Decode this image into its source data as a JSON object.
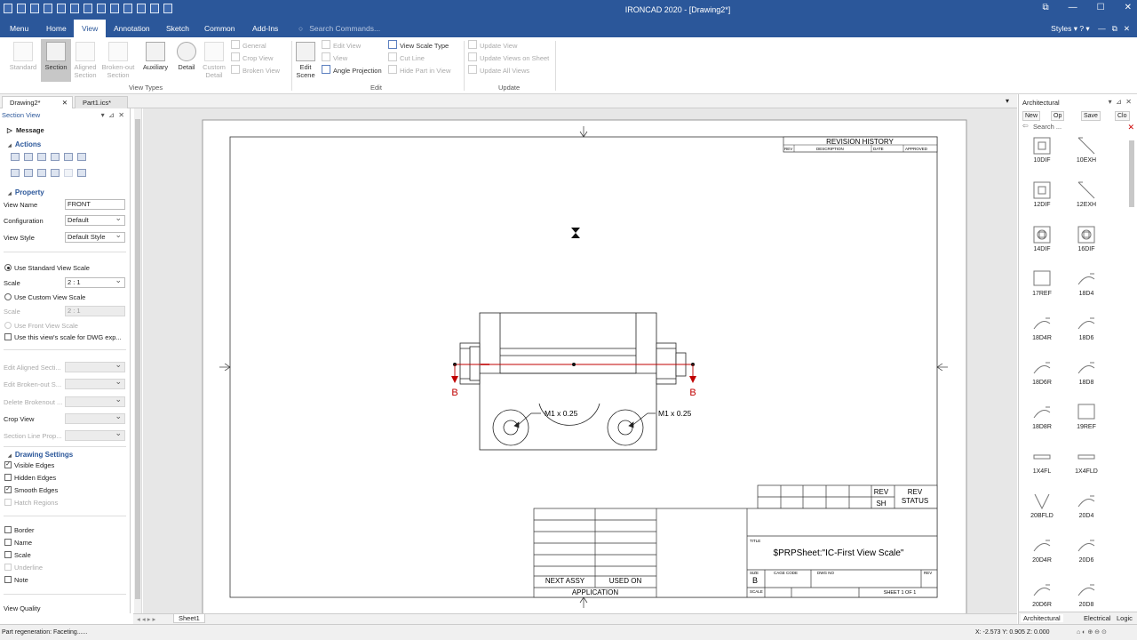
{
  "window": {
    "title": "IRONCAD 2020 - [Drawing2*]"
  },
  "menu": {
    "tabs": [
      "Menu",
      "Home",
      "View",
      "Annotation",
      "Sketch",
      "Common",
      "Add-Ins"
    ],
    "search_placeholder": "Search Commands...",
    "styles": "Styles"
  },
  "ribbon": {
    "view_types": {
      "label": "View Types",
      "standard": "Standard",
      "section": "Section",
      "aligned_section": "Aligned Section",
      "broken_out_section": "Broken-out Section",
      "auxiliary": "Auxiliary",
      "detail": "Detail",
      "custom_detail": "Custom Detail",
      "general": "General",
      "crop_view": "Crop View",
      "broken_view": "Broken View"
    },
    "edit": {
      "label": "Edit",
      "edit_scene": "Edit Scene",
      "edit_view": "Edit View",
      "view": "View",
      "angle_projection": "Angle Projection",
      "view_scale_type": "View Scale Type",
      "cut_line": "Cut Line",
      "hide_part_in_view": "Hide Part in View"
    },
    "update": {
      "label": "Update",
      "update_view": "Update View",
      "update_views_on_sheet": "Update Views on Sheet",
      "update_all_views": "Update All Views"
    }
  },
  "doc_tabs": [
    "Drawing2*",
    "Part1.ics*"
  ],
  "panel": {
    "title": "Section View",
    "message": "Message",
    "actions": "Actions",
    "property": "Property",
    "view_name_label": "View Name",
    "view_name_value": "FRONT",
    "configuration_label": "Configuration",
    "configuration_value": "Default",
    "view_style_label": "View Style",
    "view_style_value": "Default Style",
    "use_standard_scale": "Use Standard View Scale",
    "scale_label": "Scale",
    "scale_value": "2 : 1",
    "use_custom_scale": "Use Custom View Scale",
    "custom_scale_label": "Scale",
    "custom_scale_value": "2 : 1",
    "use_front_view_scale": "Use Front View Scale",
    "use_dwg_scale": "Use this view's scale for DWG exp...",
    "edit_aligned": "Edit Aligned Secti...",
    "edit_broken_out": "Edit Broken-out S...",
    "delete_brokenout": "Delete Brokenout ...",
    "crop_view": "Crop View",
    "section_line_prop": "Section Line Prop...",
    "drawing_settings": "Drawing Settings",
    "visible_edges": "Visible Edges",
    "hidden_edges": "Hidden Edges",
    "smooth_edges": "Smooth Edges",
    "hatch_regions": "Hatch Regions",
    "border": "Border",
    "name": "Name",
    "scale": "Scale",
    "underline": "Underline",
    "note": "Note",
    "view_quality": "View Quality",
    "check_mark": "✓"
  },
  "drawing": {
    "revision_history": "REVISION HISTORY",
    "rev": "REV",
    "description": "DESCRIPTION",
    "date": "DATE",
    "approved": "APPROVED",
    "section_letter": "B",
    "thread_note": "M1 x 0.25",
    "rev_label": "REV",
    "sh_label": "SH",
    "rev_status": "REV\nSTATUS",
    "rev_status_1": "REV",
    "rev_status_2": "STATUS",
    "title_label": "TITLE",
    "title_value": "$PRPSheet:\"IC-First View Scale\"",
    "size_label": "SIZE",
    "size_value": "B",
    "cage_code": "CAGE CODE",
    "dwg_no": "DWG NO",
    "rev_small": "REV",
    "scale_label": "SCALE",
    "sheet": "SHEET 1 OF 1",
    "next_assy": "NEXT ASSY",
    "used_on": "USED ON",
    "application": "APPLICATION"
  },
  "catalog": {
    "title": "Architectural",
    "toolbar": [
      "New",
      "Op",
      "Save",
      "Clo"
    ],
    "search": "Search ...",
    "items": [
      "10DIF",
      "10EXH",
      "12DIF",
      "12EXH",
      "14DIF",
      "16DIF",
      "17REF",
      "18D4",
      "18D4R",
      "18D6",
      "18D6R",
      "18D8",
      "18D8R",
      "19REF",
      "1X4FL",
      "1X4FLD",
      "20BFLD",
      "20D4",
      "20D4R",
      "20D6",
      "20D6R",
      "20D8"
    ],
    "tabs": [
      "Architectural",
      "Electrical",
      "Logic"
    ]
  },
  "sheet_tab": "Sheet1",
  "status": {
    "message": "Part regeneration: Faceting......",
    "coords": "X: -2.573 Y: 0.905 Z: 0.000"
  },
  "colors": {
    "accent": "#2b579a",
    "section_line": "#c00000"
  }
}
